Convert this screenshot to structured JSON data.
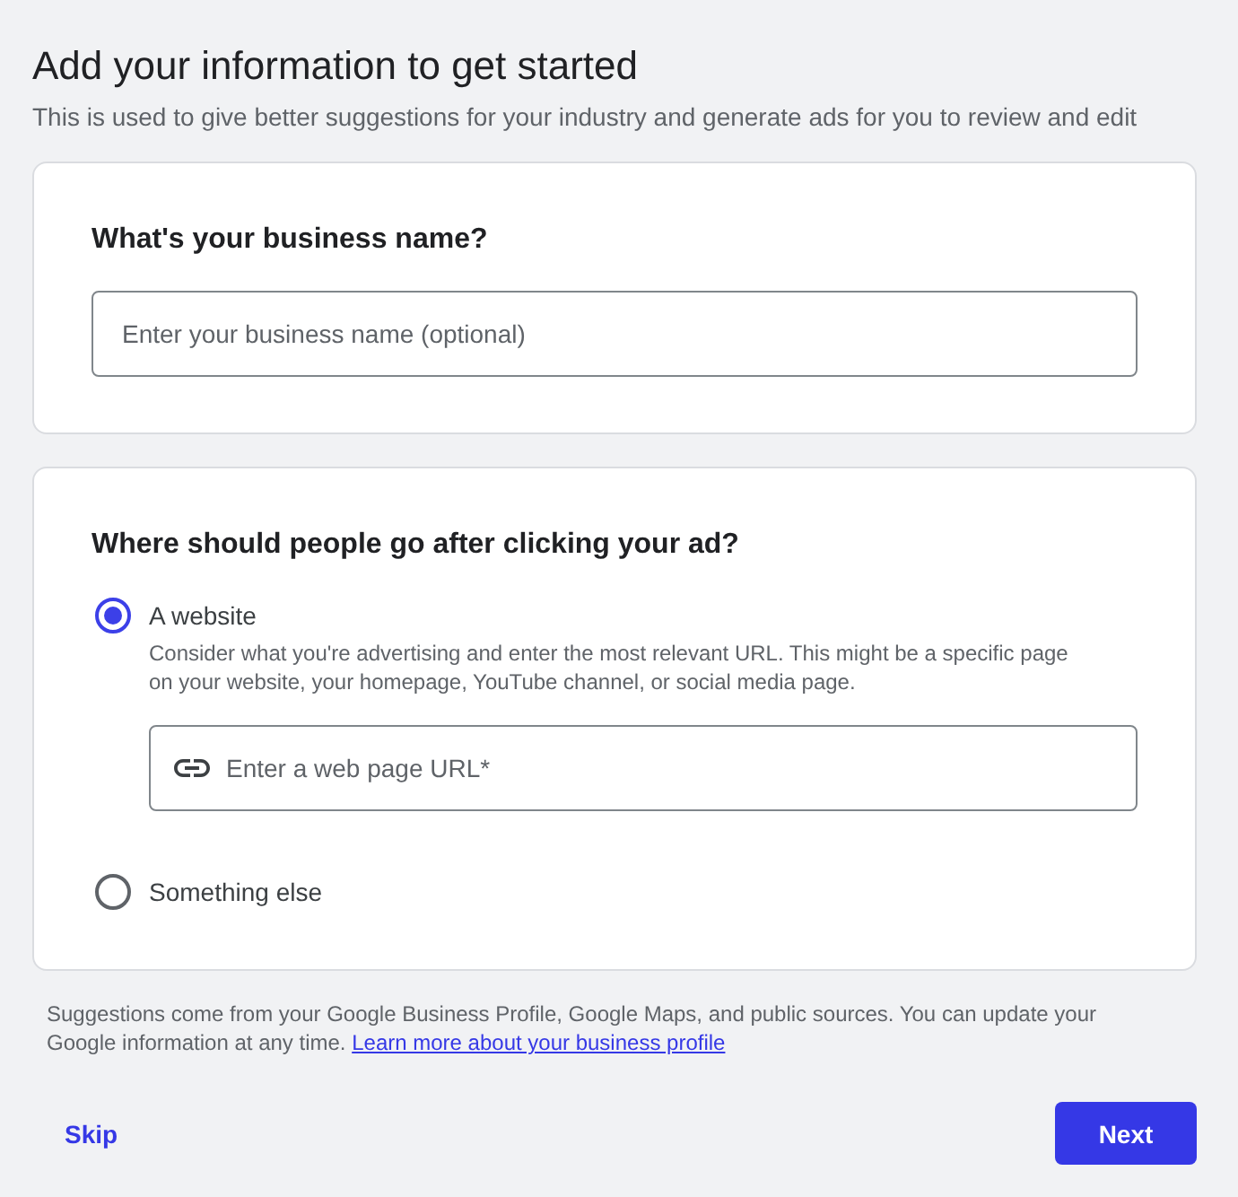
{
  "header": {
    "title": "Add your information to get started",
    "subtitle": "This is used to give better suggestions for your industry and generate ads for you to review and edit"
  },
  "business_name": {
    "heading": "What's your business name?",
    "field": {
      "placeholder": "Enter your business name (optional)"
    }
  },
  "destination": {
    "heading": "Where should people go after clicking your ad?",
    "options": [
      {
        "kind": "url",
        "label": "A website",
        "selected": true,
        "description": "Consider what you're advertising and enter the most relevant URL. This might be a specific page on your website, your homepage, YouTube channel, or social media page.",
        "field": {
          "placeholder": "Enter a web page URL*"
        }
      },
      {
        "kind": "plain",
        "label": "Something else",
        "selected": false
      }
    ]
  },
  "footer_note": {
    "text": "Suggestions come from your Google Business Profile, Google Maps, and public sources. You can update your Google information at any time.",
    "link": "Learn more about your business profile"
  },
  "actions": [
    {
      "kind": "text",
      "label": "Skip"
    },
    {
      "kind": "filled",
      "label": "Next"
    }
  ]
}
